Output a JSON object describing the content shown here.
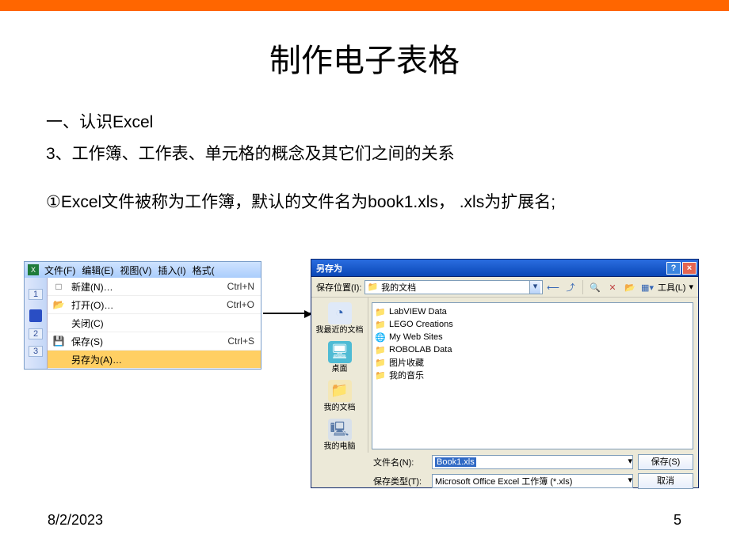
{
  "slide": {
    "title": "制作电子表格",
    "sub1": "一、认识Excel",
    "sub2": "3、工作簿、工作表、单元格的概念及其它们之间的关系",
    "body1": "①Excel文件被称为工作簿，默认的文件名为book1.xls， .xls为扩展名;"
  },
  "footer": {
    "date": "8/2/2023",
    "page": "5"
  },
  "file_menu": {
    "menubar": [
      "文件(F)",
      "编辑(E)",
      "视图(V)",
      "插入(I)",
      "格式("
    ],
    "rows": [
      "1",
      "2",
      "3"
    ],
    "items": [
      {
        "icon": "□",
        "cls": "ico-new",
        "label": "新建(N)…",
        "shortcut": "Ctrl+N"
      },
      {
        "icon": "📂",
        "cls": "ico-open",
        "label": "打开(O)…",
        "shortcut": "Ctrl+O"
      },
      {
        "icon": "",
        "cls": "",
        "label": "关闭(C)",
        "shortcut": ""
      },
      {
        "icon": "💾",
        "cls": "ico-save",
        "label": "保存(S)",
        "shortcut": "Ctrl+S"
      },
      {
        "icon": "",
        "cls": "selected",
        "label": "另存为(A)…",
        "shortcut": ""
      }
    ]
  },
  "saveas": {
    "title": "另存为",
    "loc_label": "保存位置(I):",
    "loc_value": "我的文档",
    "tools_label": "工具(L)",
    "places": [
      {
        "cls": "pico-recent",
        "icon": "◔",
        "label": "我最近的文档"
      },
      {
        "cls": "pico-desktop",
        "icon": "🖥",
        "label": "桌面"
      },
      {
        "cls": "pico-docs",
        "icon": "📁",
        "label": "我的文档"
      },
      {
        "cls": "pico-pc",
        "icon": "🖳",
        "label": "我的电脑"
      }
    ],
    "entries": [
      {
        "icon": "📁",
        "label": "LabVIEW Data"
      },
      {
        "icon": "📁",
        "label": "LEGO Creations"
      },
      {
        "iconClass": "blue",
        "icon": "🌐",
        "label": "My Web Sites"
      },
      {
        "icon": "📁",
        "label": "ROBOLAB Data"
      },
      {
        "icon": "📁",
        "label": "图片收藏"
      },
      {
        "icon": "📁",
        "label": "我的音乐"
      }
    ],
    "filename_label": "文件名(N):",
    "filename_value": "Book1.xls",
    "filetype_label": "保存类型(T):",
    "filetype_value": "Microsoft Office Excel 工作簿 (*.xls)",
    "save_btn": "保存(S)",
    "cancel_btn": "取消"
  }
}
